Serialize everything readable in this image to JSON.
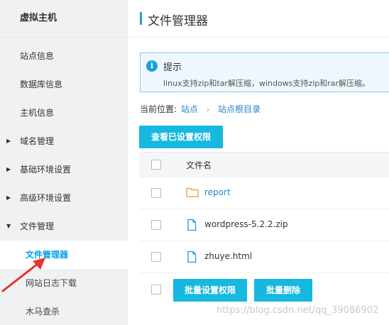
{
  "sidebar": {
    "title": "虚拟主机",
    "items": [
      {
        "label": "站点信息"
      },
      {
        "label": "数据库信息"
      },
      {
        "label": "主机信息"
      },
      {
        "label": "域名管理"
      },
      {
        "label": "基础环境设置"
      },
      {
        "label": "高级环境设置"
      },
      {
        "label": "文件管理"
      },
      {
        "label": "文件管理器"
      },
      {
        "label": "网站日志下载"
      },
      {
        "label": "木马查杀"
      }
    ]
  },
  "main": {
    "title": "文件管理器",
    "tip": {
      "title": "提示",
      "icon": "i",
      "text": "linux支持zip和tar解压缩，windows支持zip和rar解压缩。"
    },
    "breadcrumb": {
      "label": "当前位置:",
      "items": [
        "站点",
        "站点根目录"
      ]
    },
    "view_perm_button": "查看已设置权限",
    "table": {
      "header_name": "文件名",
      "rows": [
        {
          "name": "report",
          "type": "folder"
        },
        {
          "name": "wordpress-5.2.2.zip",
          "type": "file"
        },
        {
          "name": "zhuye.html",
          "type": "file"
        }
      ]
    },
    "batch_perm_button": "批量设置权限",
    "batch_delete_button": "批量删除"
  },
  "watermark": "https://blog.csdn.net/qq_39086902",
  "colors": {
    "accent": "#17b8e0",
    "link": "#1e88c8",
    "active_item": "#00a0e9",
    "annotation": "#e8322b"
  }
}
